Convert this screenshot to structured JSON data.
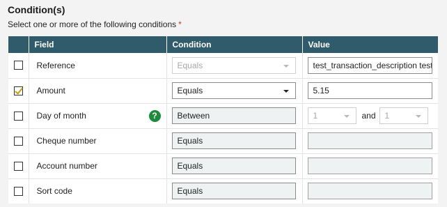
{
  "header": {
    "title": "Condition(s)",
    "subtitle": "Select one or more of the following conditions",
    "required_marker": "*"
  },
  "table": {
    "columns": [
      "",
      "Field",
      "Condition",
      "Value"
    ],
    "rows": [
      {
        "field": "Reference",
        "checked": false,
        "condition": "Equals",
        "value": "test_transaction_description test"
      },
      {
        "field": "Amount",
        "checked": true,
        "condition": "Equals",
        "value": "5.15"
      },
      {
        "field": "Day of month",
        "checked": false,
        "condition": "Between",
        "value_from": "1",
        "and_label": "and",
        "value_to": "1",
        "help_icon": "question-icon"
      },
      {
        "field": "Cheque number",
        "checked": false,
        "condition": "Equals",
        "value": ""
      },
      {
        "field": "Account number",
        "checked": false,
        "condition": "Equals",
        "value": ""
      },
      {
        "field": "Sort code",
        "checked": false,
        "condition": "Equals",
        "value": ""
      }
    ]
  },
  "colors": {
    "header_bg": "#2f5b6a",
    "check_mark": "#c99a0a",
    "help_icon": "#1e8a3c",
    "required": "#c0392b"
  }
}
